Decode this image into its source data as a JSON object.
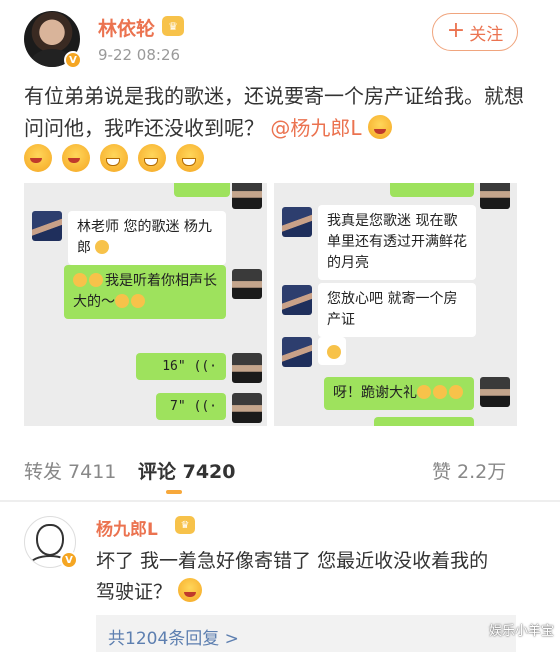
{
  "post": {
    "author": "林依轮",
    "author_crown": "♛",
    "verified": "V",
    "timestamp": "9-22 08:26",
    "follow_label": "关注",
    "follow_icon": "+",
    "text_before": "有位弟弟说是我的歌迷，还说要寄一个房产证给我。就想问问他，我咋还没收到呢？",
    "mention": "@杨九郎L"
  },
  "chat_left": {
    "msg1": "林老师 您的歌迷 杨九郎",
    "msg2": "我是听着你相声长大的～",
    "voice1": "16\" ((·",
    "voice2": "7\" ((·"
  },
  "chat_right": {
    "msg1": "我真是您歌迷 现在歌单里还有透过开满鲜花的月亮",
    "msg2": "您放心吧 就寄一个房产证",
    "msg3": "呀！跪谢大礼"
  },
  "stats": {
    "repost": "转发 7411",
    "comment": "评论 7420",
    "like": "赞 2.2万"
  },
  "comment": {
    "author": "杨九郎L",
    "author_crown": "♛",
    "verified": "V",
    "text": "坏了 我一着急好像寄错了 您最近收没收着我的驾驶证？",
    "replies": "共1204条回复 >"
  },
  "watermark": "娱乐小羊宝",
  "colors": {
    "accent": "#eb7350",
    "link": "#5d7fb0",
    "chat_green": "#9ee25d"
  }
}
